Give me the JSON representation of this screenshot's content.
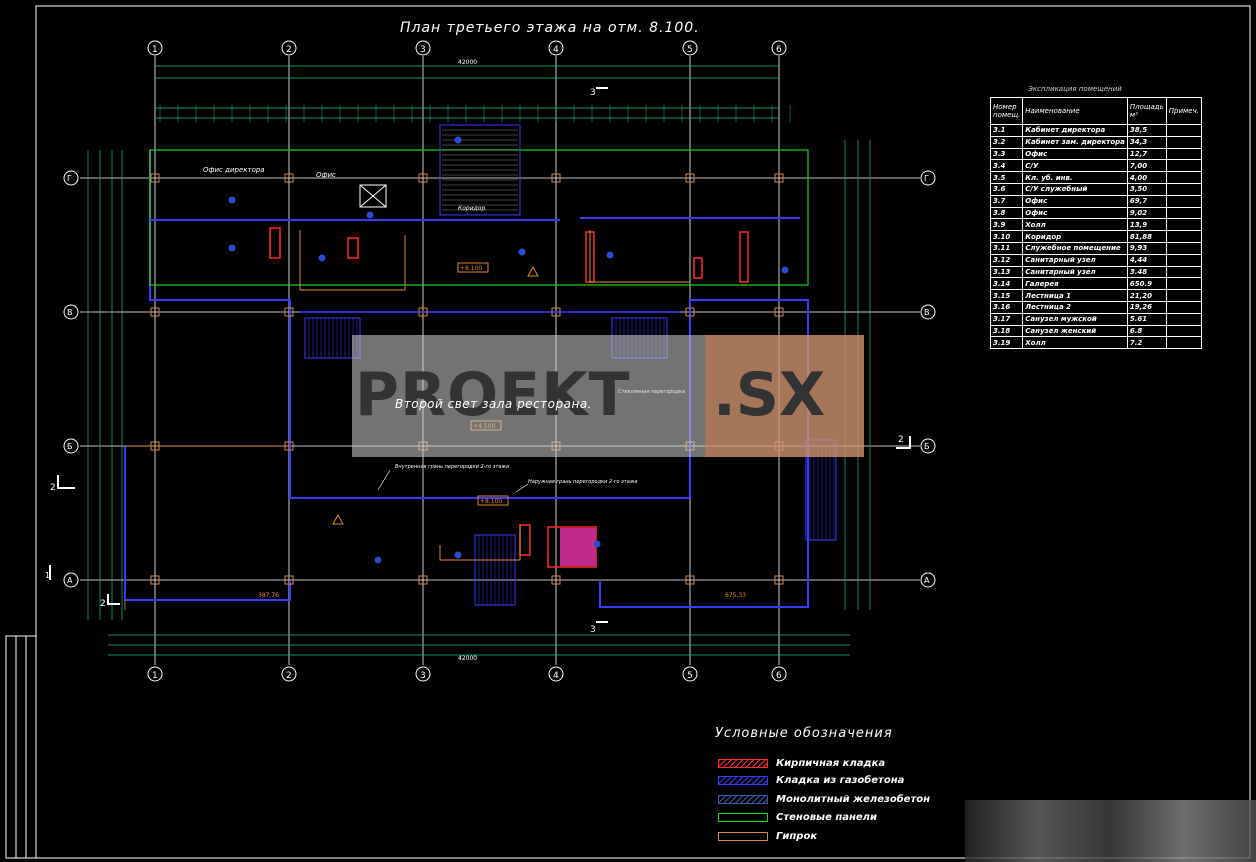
{
  "plan": {
    "title": "План третьего этажа на отм. 8.100.",
    "column_axes": [
      "1",
      "2",
      "3",
      "4",
      "5",
      "6"
    ],
    "row_axes": [
      "Г",
      "В",
      "Б",
      "А"
    ],
    "overall_dimension": "42000",
    "section_marks": [
      "3",
      "3",
      "2",
      "2",
      "2",
      "1"
    ],
    "room_labels": {
      "office_director": "Офис директора",
      "office": "Офис",
      "corridor": "Коридор",
      "second_light": "Второй свет зала ресторана.",
      "glass_partition": "Стеклянная перегородка",
      "inner_face": "Внутренняя грань перегородки 2-го этажа",
      "outer_face": "Наружная грань перегородки 2-го этажа"
    },
    "elevation_marks": [
      "+8.100",
      "+4.500",
      "+8.100"
    ],
    "areas": [
      "387,76",
      "675,33"
    ]
  },
  "watermark": {
    "left": "PROEKT",
    "right": ".SX"
  },
  "explication": {
    "title": "Экспликация помещений",
    "headers": [
      "Номер помещ.",
      "Наименование",
      "Площадь м²",
      "Примеч."
    ],
    "rows": [
      [
        "3.1",
        "Кабинет директора",
        "38,5"
      ],
      [
        "3.2",
        "Кабинет зам. директора",
        "34,3"
      ],
      [
        "3.3",
        "Офис",
        "12,7"
      ],
      [
        "3.4",
        "С/У",
        "7,00"
      ],
      [
        "3.5",
        "Кл. уб. инв.",
        "4,00"
      ],
      [
        "3.6",
        "С/У служебный",
        "3,50"
      ],
      [
        "3.7",
        "Офис",
        "69,7"
      ],
      [
        "3.8",
        "Офис",
        "9,02"
      ],
      [
        "3.9",
        "Холл",
        "13,9"
      ],
      [
        "3.10",
        "Коридор",
        "81,88"
      ],
      [
        "3.11",
        "Служебное помещение",
        "9,93"
      ],
      [
        "3.12",
        "Санитарный узел",
        "4,44"
      ],
      [
        "3.13",
        "Санитарный узел",
        "3.48"
      ],
      [
        "3.14",
        "Галерея",
        "650.9"
      ],
      [
        "3.15",
        "Лестница 1",
        "21,20"
      ],
      [
        "3.16",
        "Лестница 2",
        "19,26"
      ],
      [
        "3.17",
        "Санузел мужской",
        "5.61"
      ],
      [
        "3.18",
        "Санузел женский",
        "6.8"
      ],
      [
        "3.19",
        "Холл",
        "7.2"
      ]
    ]
  },
  "legend": {
    "title": "Условные обозначения",
    "items": [
      {
        "label": "Кирпичная кладка",
        "color": "#ff2a2a"
      },
      {
        "label": "Кладка из газобетона",
        "color": "#3a3aff"
      },
      {
        "label": "Монолитный железобетон",
        "color": "#3a5aaa"
      },
      {
        "label": "Стеновые панели",
        "color": "#19d619"
      },
      {
        "label": "Гипрок",
        "color": "#d48a4a"
      }
    ]
  },
  "colors": {
    "dim": "#19c07a",
    "wall": "#3a3aff",
    "grid": "#ffffff",
    "accent": "#e08a2a"
  }
}
